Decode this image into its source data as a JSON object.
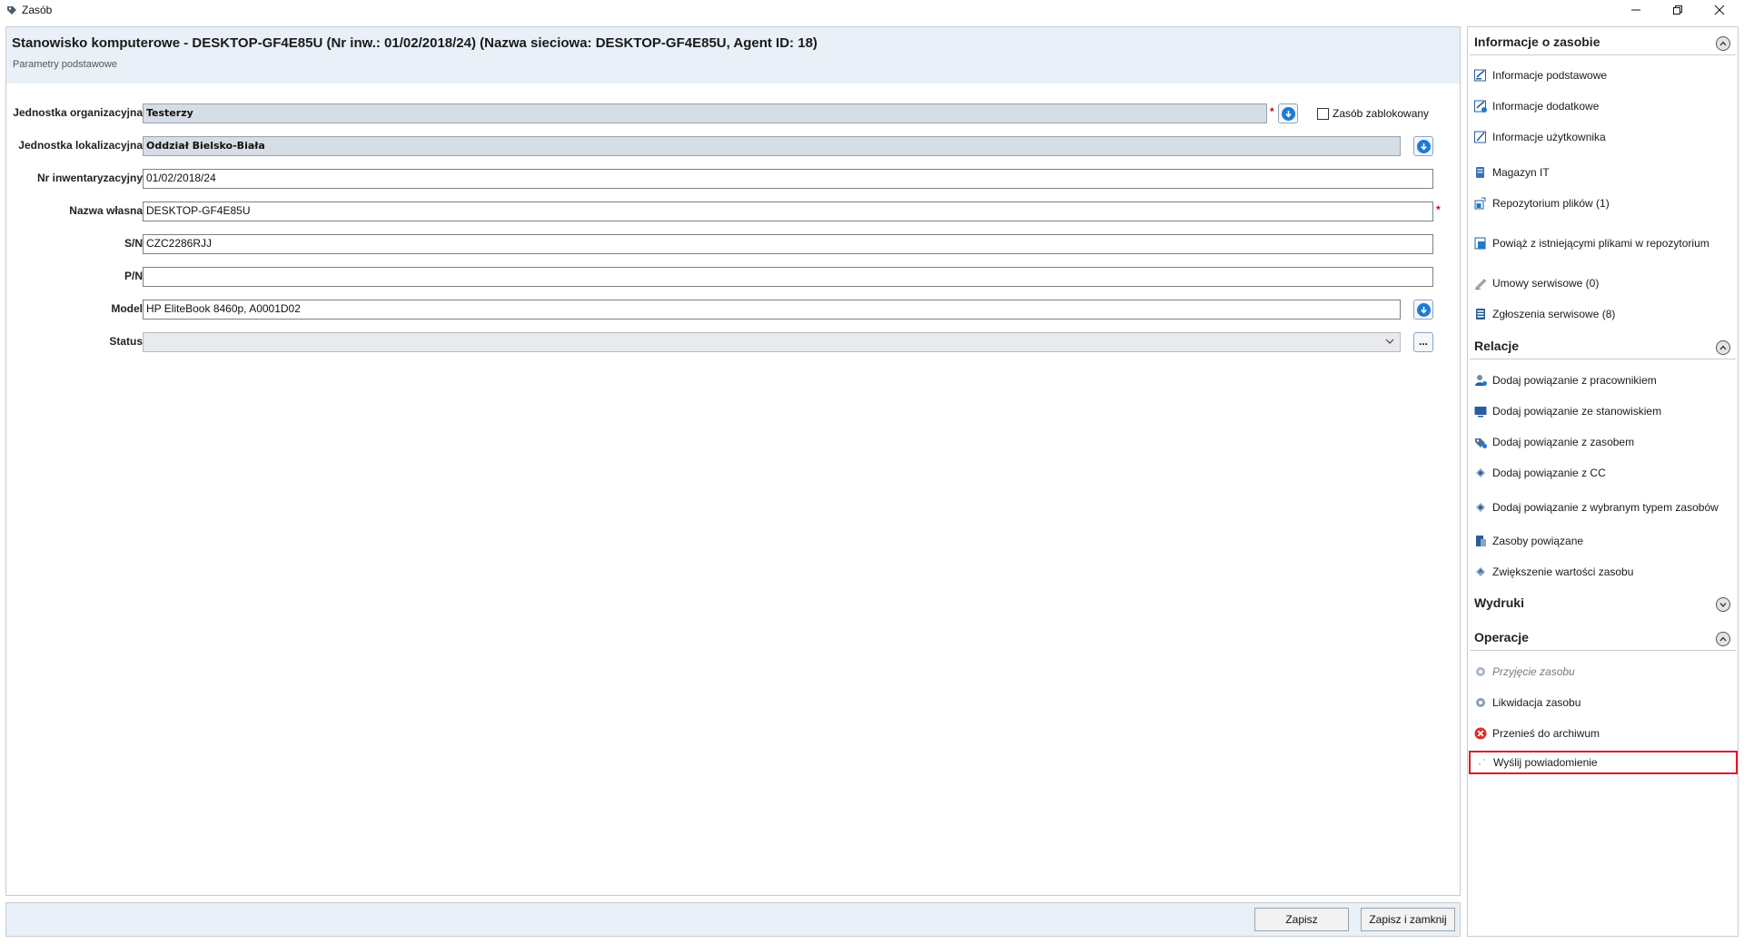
{
  "window": {
    "title": "Zasób"
  },
  "header": {
    "title": "Stanowisko komputerowe - DESKTOP-GF4E85U (Nr inw.: 01/02/2018/24) (Nazwa sieciowa: DESKTOP-GF4E85U, Agent ID: 18)",
    "subtitle": "Parametry podstawowe"
  },
  "form": {
    "org_unit": {
      "label": "Jednostka organizacyjna",
      "value": "Testerzy"
    },
    "locked": {
      "label": "Zasób zablokowany",
      "checked": false
    },
    "location_unit": {
      "label": "Jednostka lokalizacyjna",
      "value": "Oddział Bielsko-Biała"
    },
    "inventory_no": {
      "label": "Nr inwentaryzacyjny",
      "value": "01/02/2018/24"
    },
    "own_name": {
      "label": "Nazwa własna",
      "value": "DESKTOP-GF4E85U"
    },
    "serial": {
      "label": "S/N",
      "value": "CZC2286RJJ"
    },
    "part_no": {
      "label": "P/N",
      "value": ""
    },
    "model": {
      "label": "Model",
      "value": "HP EliteBook 8460p, A0001D02"
    },
    "status": {
      "label": "Status",
      "value": ""
    },
    "required_mark": "*",
    "dots_label": "..."
  },
  "buttons": {
    "save": "Zapisz",
    "save_close": "Zapisz i zamknij"
  },
  "sidebar": {
    "info": {
      "title": "Informacje o zasobie",
      "items": [
        {
          "label": "Informacje podstawowe",
          "icon": "info-basic-icon"
        },
        {
          "label": "Informacje dodatkowe",
          "icon": "info-extra-icon"
        },
        {
          "label": "Informacje użytkownika",
          "icon": "user-info-icon"
        },
        {
          "label": "Magazyn IT",
          "icon": "warehouse-icon"
        },
        {
          "label": "Repozytorium plików (1)",
          "icon": "file-repo-icon"
        },
        {
          "label": "Powiąż z istniejącymi plikami w repozytorium",
          "icon": "link-files-icon"
        },
        {
          "label": "Umowy serwisowe (0)",
          "icon": "contract-icon"
        },
        {
          "label": "Zgłoszenia serwisowe (8)",
          "icon": "tickets-icon"
        }
      ]
    },
    "relations": {
      "title": "Relacje",
      "items": [
        {
          "label": "Dodaj powiązanie z pracownikiem",
          "icon": "employee-link-icon"
        },
        {
          "label": "Dodaj powiązanie ze stanowiskiem",
          "icon": "workstation-link-icon"
        },
        {
          "label": "Dodaj powiązanie z zasobem",
          "icon": "asset-link-icon"
        },
        {
          "label": "Dodaj powiązanie z CC",
          "icon": "cc-link-icon"
        },
        {
          "label": "Dodaj powiązanie z wybranym typem zasobów",
          "icon": "type-link-icon"
        },
        {
          "label": "Zasoby powiązane",
          "icon": "related-assets-icon"
        },
        {
          "label": "Zwiększenie wartości zasobu",
          "icon": "value-increase-icon"
        }
      ]
    },
    "prints": {
      "title": "Wydruki"
    },
    "operations": {
      "title": "Operacje",
      "items": [
        {
          "label": "Przyjęcie zasobu",
          "icon": "receive-asset-icon"
        },
        {
          "label": "Likwidacja zasobu",
          "icon": "liquidate-asset-icon"
        },
        {
          "label": "Przenieś do archiwum",
          "icon": "archive-icon"
        },
        {
          "label": "Wyślij powiadomienie",
          "icon": "send-notification-icon"
        }
      ]
    }
  },
  "colors": {
    "header_bg": "#e9f0f8",
    "accent_blue": "#1e7ad4",
    "highlight_red": "#e0192a",
    "required_red": "#d0021b"
  }
}
